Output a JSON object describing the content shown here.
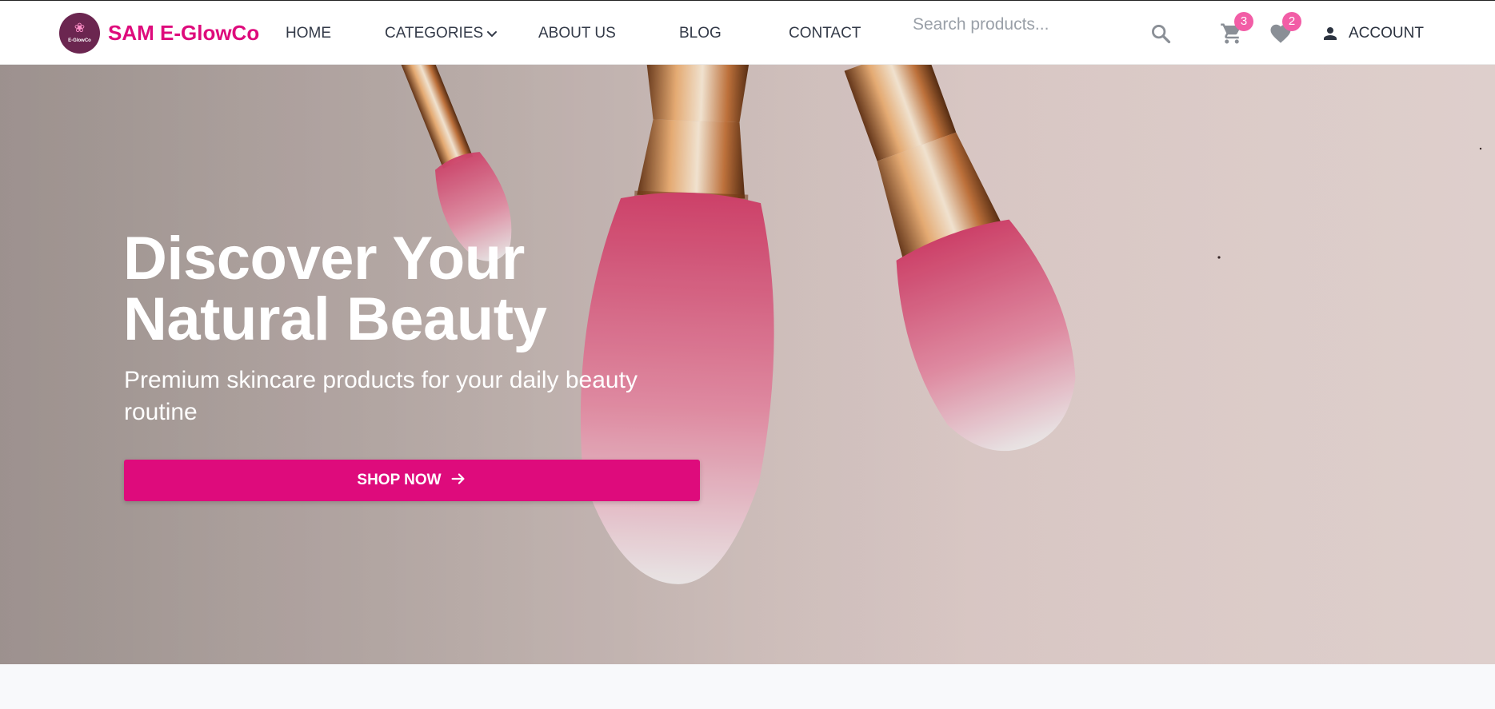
{
  "brand": {
    "logo_text": "E-GlowCo",
    "name": "SAM E-GlowCo",
    "accent_color": "#de0b7c"
  },
  "nav": {
    "home": "HOME",
    "categories": "CATEGORIES",
    "about": "ABOUT US",
    "blog": "BLOG",
    "contact": "CONTACT"
  },
  "search": {
    "placeholder": "Search products...",
    "icon": "search-icon"
  },
  "cart": {
    "icon": "cart-icon",
    "count": "3"
  },
  "wishlist": {
    "icon": "heart-icon",
    "count": "2"
  },
  "account": {
    "icon": "person-icon",
    "label": "ACCOUNT"
  },
  "hero": {
    "title_line1": "Discover Your",
    "title_line2": "Natural Beauty",
    "subtitle": "Premium skincare products for your daily beauty routine",
    "cta_label": "SHOP NOW",
    "cta_icon": "arrow-right-icon",
    "image": "makeup-brushes-image"
  },
  "colors": {
    "badge": "#f25da6",
    "nav_text": "#333a48"
  }
}
